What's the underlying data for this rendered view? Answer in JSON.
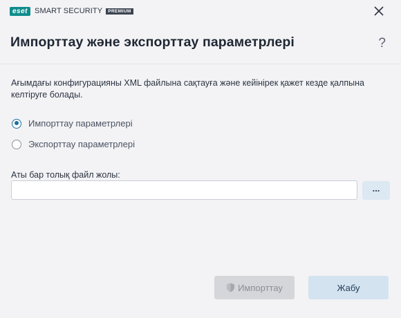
{
  "window": {
    "brand_logo": "eset",
    "brand_product": "SMART SECURITY",
    "brand_edition": "PREMIUM"
  },
  "header": {
    "title": "Импорттау және экспорттау параметрлері",
    "help_icon": "?"
  },
  "description": "Ағымдағы конфигурацияны XML файлына сақтауға және кейінірек қажет кезде қалпына келтіруге болады.",
  "options": [
    {
      "label": "Импорттау параметрлері",
      "selected": true
    },
    {
      "label": "Экспорттау параметрлері",
      "selected": false
    }
  ],
  "file_path": {
    "label": "Аты бар толық файл жолы:",
    "value": "",
    "browse_label": "..."
  },
  "buttons": {
    "import_label": "Импорттау",
    "close_label": "Жабу"
  },
  "colors": {
    "accent": "#1f6f9f",
    "brand": "#0f8c8c",
    "background": "#f3f3f6"
  }
}
